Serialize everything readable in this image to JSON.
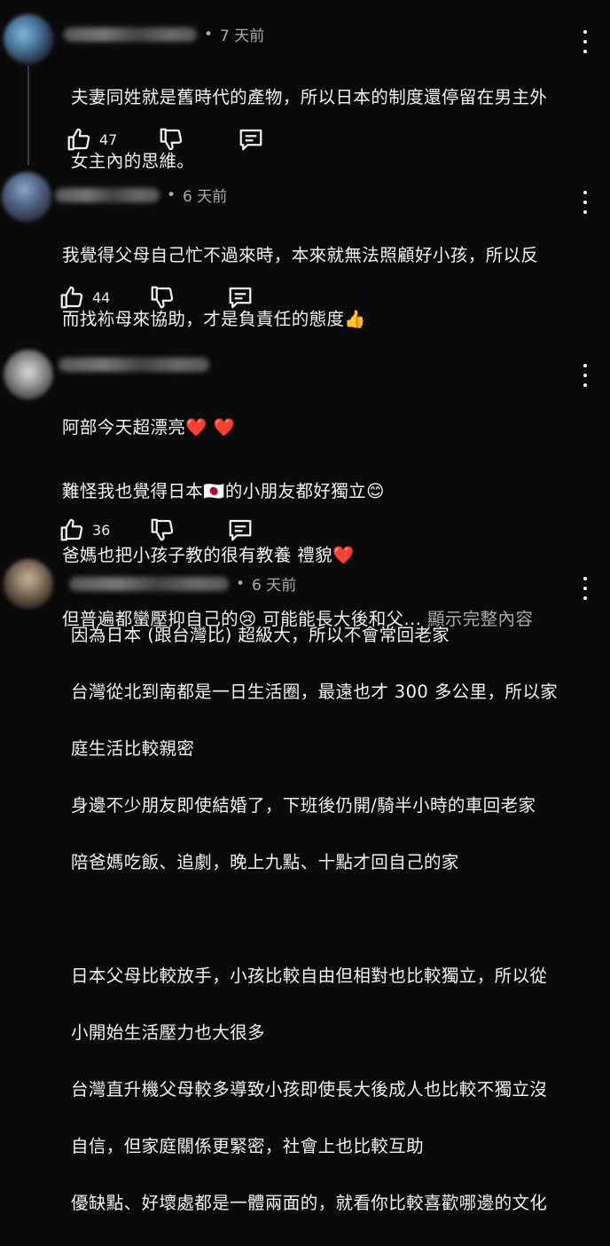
{
  "comments": [
    {
      "time": "7 天前",
      "lines": [
        "夫妻同姓就是舊時代的產物，所以日本的制度還停留在男主外",
        "女主內的思維。"
      ],
      "likes": "47"
    },
    {
      "time": "6 天前",
      "lines": [
        "我覺得父母自己忙不過來時，本來就無法照顧好小孩，所以反",
        "而找袮母來協助，才是負責任的態度👍"
      ],
      "likes": "44"
    },
    {
      "time": "",
      "lines": [
        "阿部今天超漂亮❤️ ❤️",
        "難怪我也覺得日本🇯🇵的小朋友都好獨立😊",
        "爸媽也把小孩子教的很有教養 禮貌❤️",
        "但普遍都蠻壓抑自己的😢 可能能長大後和父..."
      ],
      "show_more": "顯示完整內容",
      "likes": "36"
    },
    {
      "time": "6 天前",
      "lines": [
        "因為日本 (跟台灣比) 超級大，所以不會常回老家",
        "台灣從北到南都是一日生活圈，最遠也才 300 多公里，所以家",
        "庭生活比較親密",
        "身邊不少朋友即使結婚了，下班後仍開/騎半小時的車回老家",
        "陪爸媽吃飯、追劇，晚上九點、十點才回自己的家",
        "",
        "日本父母比較放手，小孩比較自由但相對也比較獨立，所以從",
        "小開始生活壓力也大很多",
        "台灣直升機父母較多導致小孩即使長大後成人也比較不獨立沒",
        "自信，但家庭關係更緊密，社會上也比較互助",
        "優缺點、好壞處都是一體兩面的，就看你比較喜歡哪邊的文化"
      ]
    }
  ],
  "icons": [
    "thumb-up-icon",
    "thumb-down-icon",
    "reply-icon",
    "more-vert-icon"
  ]
}
